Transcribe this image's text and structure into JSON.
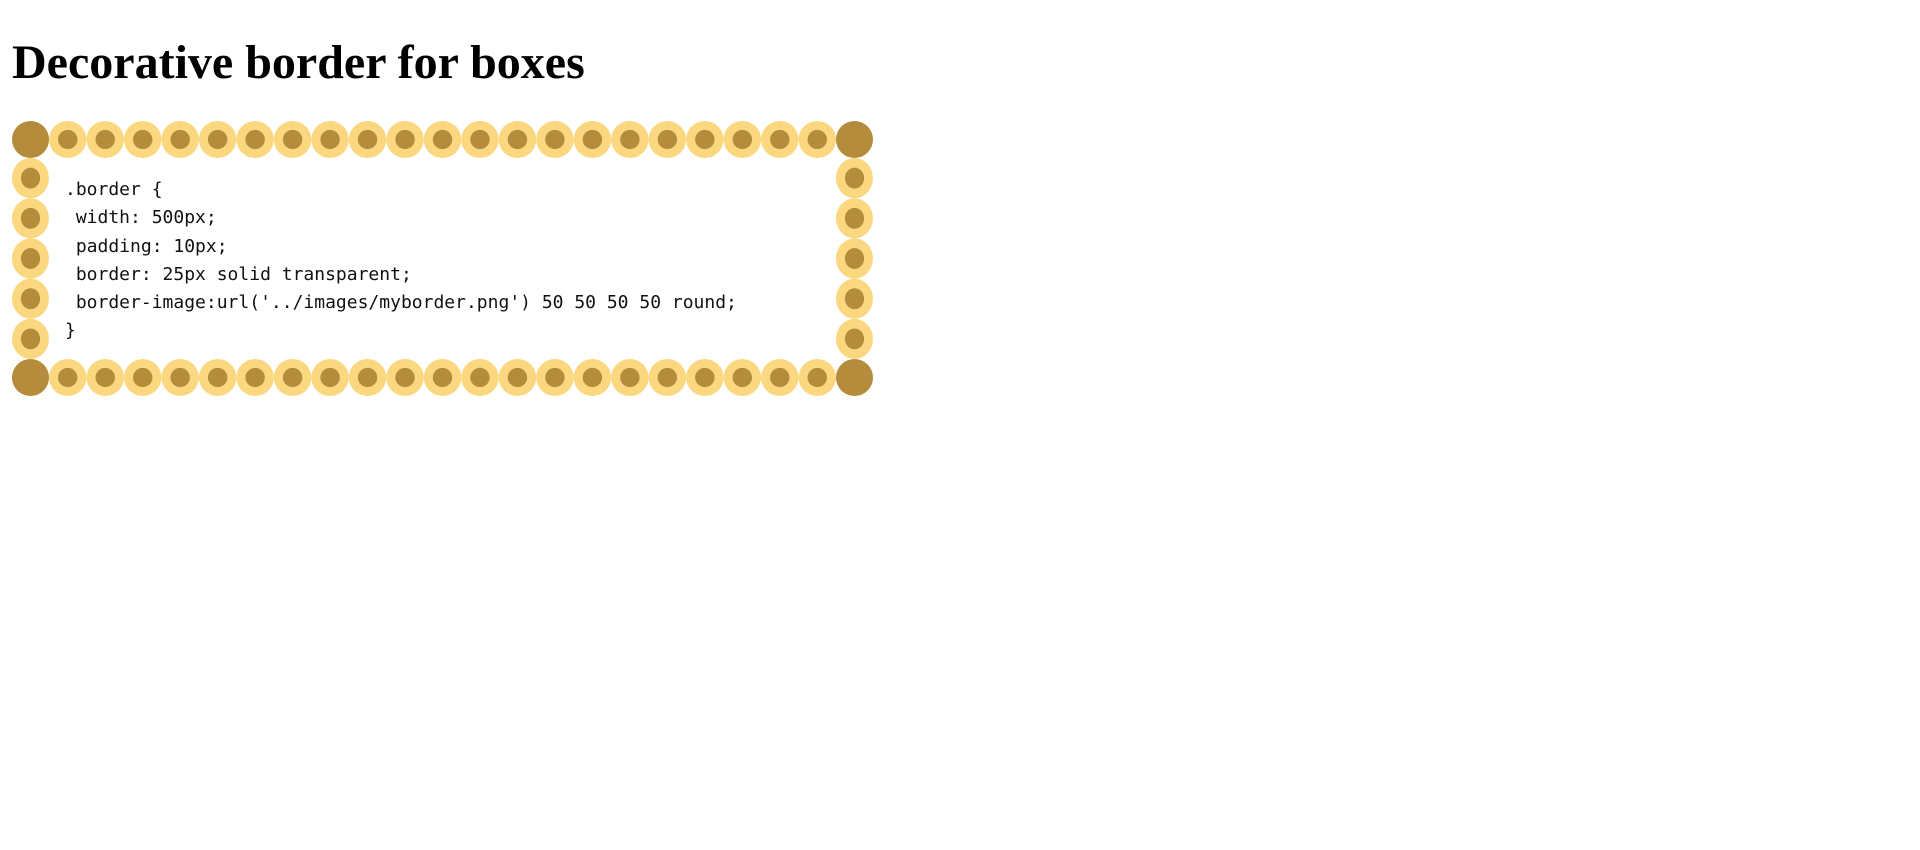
{
  "page": {
    "title": "Decorative border for boxes"
  },
  "code": {
    "lines": [
      ".border {",
      " width: 500px;",
      " padding: 10px;",
      " border: 25px solid transparent;",
      " border-image:url('../images/myborder.png') 50 50 50 50 round;",
      "}"
    ]
  },
  "theme": {
    "ring_color": "#fbd87f",
    "dot_color": "#b48c3c",
    "background": "#ffffff"
  }
}
